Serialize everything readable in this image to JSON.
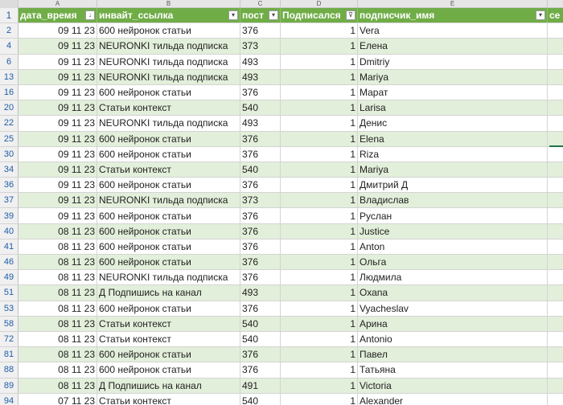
{
  "column_letters": [
    "A",
    "B",
    "C",
    "D",
    "E",
    ""
  ],
  "headers": {
    "row_number": "1",
    "a": "дата_время",
    "b": "инвайт_ссылка",
    "c": "пост",
    "d": "Подписался",
    "e": "подписчик_имя",
    "f": "се"
  },
  "filter_icons": {
    "a": "sort-descending-filter-icon",
    "b": "dropdown-filter-icon",
    "c": "dropdown-filter-icon",
    "d": "active-filter-icon",
    "e": "dropdown-filter-icon"
  },
  "filter_glyphs": {
    "sort": "↓",
    "dropdown": "▾",
    "filtered": "⊽"
  },
  "colors": {
    "header_bg": "#70ad47",
    "band_bg": "#e2efda",
    "row_number_text": "#1f5da8"
  },
  "rows": [
    {
      "rn": "2",
      "date": "09 11 23",
      "link": "600 нейронок статьи",
      "post": "376",
      "sub": "1",
      "name": "Vera"
    },
    {
      "rn": "4",
      "date": "09 11 23",
      "link": "NEURONKI тильда подписка",
      "post": "373",
      "sub": "1",
      "name": "Елена"
    },
    {
      "rn": "6",
      "date": "09 11 23",
      "link": "NEURONKI тильда подписка",
      "post": "493",
      "sub": "1",
      "name": "Dmitriy"
    },
    {
      "rn": "13",
      "date": "09 11 23",
      "link": "NEURONKI тильда подписка",
      "post": "493",
      "sub": "1",
      "name": "Mariya"
    },
    {
      "rn": "16",
      "date": "09 11 23",
      "link": "600 нейронок статьи",
      "post": "376",
      "sub": "1",
      "name": "Марат"
    },
    {
      "rn": "20",
      "date": "09 11 23",
      "link": "Статьи контекст",
      "post": "540",
      "sub": "1",
      "name": "Larisa"
    },
    {
      "rn": "22",
      "date": "09 11 23",
      "link": "NEURONKI тильда подписка",
      "post": "493",
      "sub": "1",
      "name": "Денис"
    },
    {
      "rn": "25",
      "date": "09 11 23",
      "link": "600 нейронок статьи",
      "post": "376",
      "sub": "1",
      "name": "Elena"
    },
    {
      "rn": "30",
      "date": "09 11 23",
      "link": "600 нейронок статьи",
      "post": "376",
      "sub": "1",
      "name": "Riza"
    },
    {
      "rn": "34",
      "date": "09 11 23",
      "link": "Статьи контекст",
      "post": "540",
      "sub": "1",
      "name": "Mariya"
    },
    {
      "rn": "36",
      "date": "09 11 23",
      "link": "600 нейронок статьи",
      "post": "376",
      "sub": "1",
      "name": "Дмитрий Д"
    },
    {
      "rn": "37",
      "date": "09 11 23",
      "link": "NEURONKI тильда подписка",
      "post": "373",
      "sub": "1",
      "name": "Владислав"
    },
    {
      "rn": "39",
      "date": "09 11 23",
      "link": "600 нейронок статьи",
      "post": "376",
      "sub": "1",
      "name": "Руслан"
    },
    {
      "rn": "40",
      "date": "08 11 23",
      "link": "600 нейронок статьи",
      "post": "376",
      "sub": "1",
      "name": "Justice"
    },
    {
      "rn": "41",
      "date": "08 11 23",
      "link": "600 нейронок статьи",
      "post": "376",
      "sub": "1",
      "name": "Anton"
    },
    {
      "rn": "46",
      "date": "08 11 23",
      "link": "600 нейронок статьи",
      "post": "376",
      "sub": "1",
      "name": "Ольга"
    },
    {
      "rn": "49",
      "date": "08 11 23",
      "link": "NEURONKI тильда подписка",
      "post": "376",
      "sub": "1",
      "name": "Людмила"
    },
    {
      "rn": "51",
      "date": "08 11 23",
      "link": "Д Подпишись на канал",
      "post": "493",
      "sub": "1",
      "name": "Охаnа"
    },
    {
      "rn": "53",
      "date": "08 11 23",
      "link": "600 нейронок статьи",
      "post": "376",
      "sub": "1",
      "name": "Vyacheslav"
    },
    {
      "rn": "58",
      "date": "08 11 23",
      "link": "Статьи контекст",
      "post": "540",
      "sub": "1",
      "name": "Арина"
    },
    {
      "rn": "72",
      "date": "08 11 23",
      "link": "Статьи контекст",
      "post": "540",
      "sub": "1",
      "name": "Antonio"
    },
    {
      "rn": "81",
      "date": "08 11 23",
      "link": "600 нейронок статьи",
      "post": "376",
      "sub": "1",
      "name": "Павел"
    },
    {
      "rn": "88",
      "date": "08 11 23",
      "link": "600 нейронок статьи",
      "post": "376",
      "sub": "1",
      "name": "Татьяна"
    },
    {
      "rn": "89",
      "date": "08 11 23",
      "link": "Д Подпишись на канал",
      "post": "491",
      "sub": "1",
      "name": "Victoria"
    },
    {
      "rn": "94",
      "date": "07 11 23",
      "link": "Статьи контекст",
      "post": "540",
      "sub": "1",
      "name": "Alexander"
    }
  ]
}
